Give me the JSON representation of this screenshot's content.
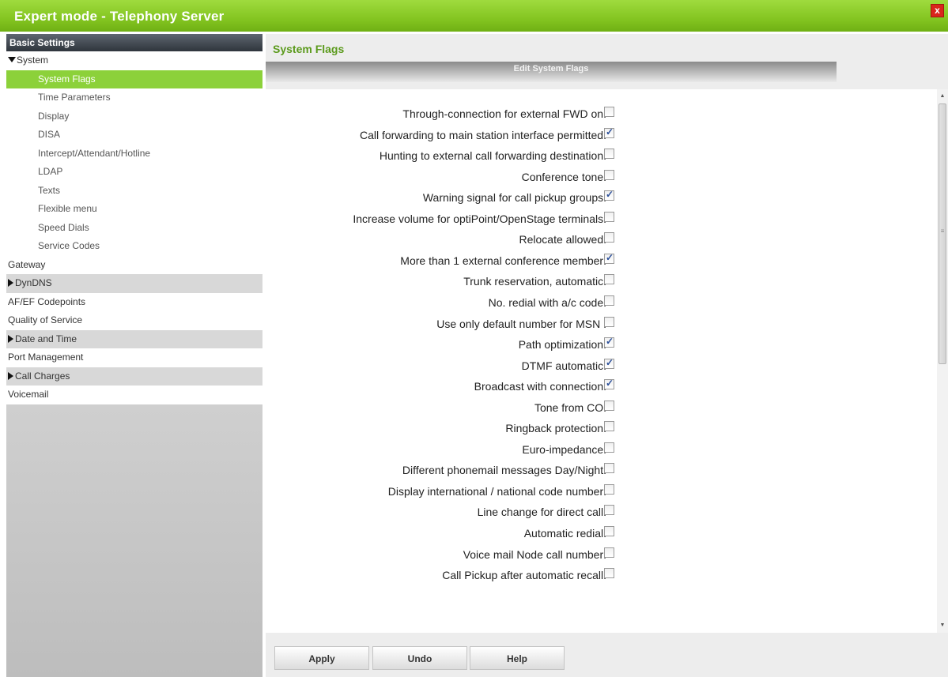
{
  "window": {
    "title": "Expert mode - Telephony Server",
    "close_label": "x"
  },
  "sidebar": {
    "header": "Basic Settings",
    "items": [
      {
        "label": "System",
        "level": 1,
        "expanded": true
      },
      {
        "label": "System Flags",
        "level": 2,
        "active": true
      },
      {
        "label": "Time Parameters",
        "level": 2
      },
      {
        "label": "Display",
        "level": 2
      },
      {
        "label": "DISA",
        "level": 2
      },
      {
        "label": "Intercept/Attendant/Hotline",
        "level": 2
      },
      {
        "label": "LDAP",
        "level": 2
      },
      {
        "label": "Texts",
        "level": 2
      },
      {
        "label": "Flexible menu",
        "level": 2
      },
      {
        "label": "Speed Dials",
        "level": 2
      },
      {
        "label": "Service Codes",
        "level": 2
      },
      {
        "label": "Gateway",
        "level": 1
      },
      {
        "label": "DynDNS",
        "level": 1,
        "collapsed": true
      },
      {
        "label": "AF/EF Codepoints",
        "level": 1
      },
      {
        "label": "Quality of Service",
        "level": 1
      },
      {
        "label": "Date and Time",
        "level": 1,
        "collapsed": true
      },
      {
        "label": "Port Management",
        "level": 1
      },
      {
        "label": "Call Charges",
        "level": 1,
        "collapsed": true
      },
      {
        "label": "Voicemail",
        "level": 1
      }
    ]
  },
  "main": {
    "title": "System Flags",
    "section_header": "Edit System Flags",
    "flags": [
      {
        "label": "Through-connection for external FWD on:",
        "checked": false
      },
      {
        "label": "Call forwarding to main station interface permitted:",
        "checked": true
      },
      {
        "label": "Hunting to external call forwarding destination:",
        "checked": false
      },
      {
        "label": "Conference tone:",
        "checked": false
      },
      {
        "label": "Warning signal for call pickup groups:",
        "checked": true
      },
      {
        "label": "Increase volume for optiPoint/OpenStage terminals:",
        "checked": false
      },
      {
        "label": "Relocate allowed:",
        "checked": false
      },
      {
        "label": "More than 1 external conference member:",
        "checked": true
      },
      {
        "label": "Trunk reservation, automatic:",
        "checked": false
      },
      {
        "label": "No. redial with a/c code:",
        "checked": false
      },
      {
        "label": "Use only default number for MSN :",
        "checked": false
      },
      {
        "label": "Path optimization:",
        "checked": true
      },
      {
        "label": "DTMF automatic:",
        "checked": true
      },
      {
        "label": "Broadcast with connection:",
        "checked": true
      },
      {
        "label": "Tone from CO:",
        "checked": false
      },
      {
        "label": "Ringback protection:",
        "checked": false
      },
      {
        "label": "Euro-impedance:",
        "checked": false
      },
      {
        "label": "Different phonemail messages Day/Night:",
        "checked": false
      },
      {
        "label": "Display international / national code number:",
        "checked": false
      },
      {
        "label": "Line change for direct call:",
        "checked": false
      },
      {
        "label": "Automatic redial:",
        "checked": false
      },
      {
        "label": "Voice mail Node call number:",
        "checked": false
      },
      {
        "label": "Call Pickup after automatic recall:",
        "checked": false
      }
    ],
    "buttons": {
      "apply": "Apply",
      "undo": "Undo",
      "help": "Help"
    }
  }
}
